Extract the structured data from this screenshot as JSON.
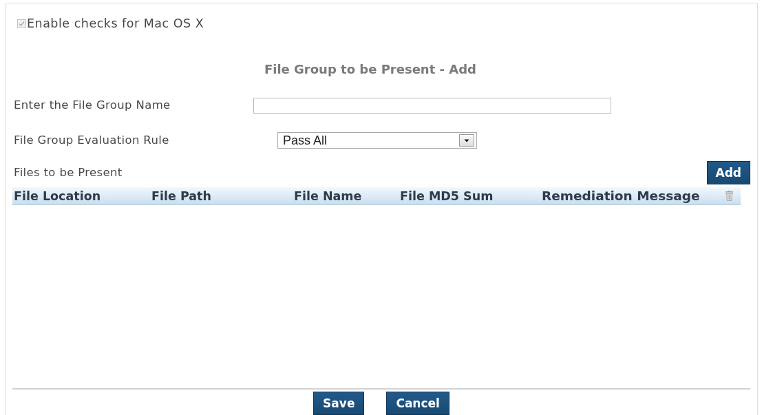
{
  "option": {
    "label": "Enable checks for Mac OS X",
    "checked": true,
    "disabled": true
  },
  "dialog": {
    "title": "File Group to be Present - Add"
  },
  "fields": [
    {
      "kind": "text",
      "label": "Enter the File Group Name"
    },
    {
      "kind": "select",
      "label": "File Group Evaluation Rule",
      "value": "Pass All"
    }
  ],
  "files_table": {
    "title": "Files to be Present",
    "add_button": "Add",
    "columns": [
      "File Location",
      "File Path",
      "File Name",
      "File MD5 Sum",
      "Remediation Message"
    ]
  },
  "buttons": [
    "Save",
    "Cancel"
  ]
}
